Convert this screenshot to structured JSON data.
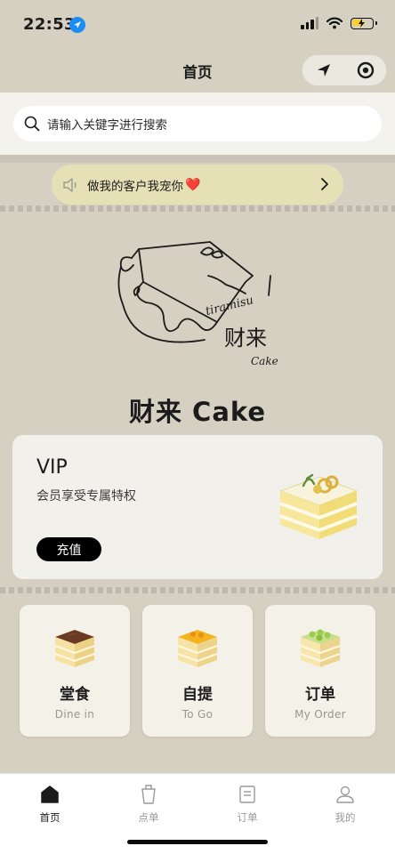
{
  "status_bar": {
    "time": "22:53"
  },
  "nav": {
    "title": "首页"
  },
  "search": {
    "placeholder": "请输入关键字进行搜索"
  },
  "notice": {
    "text": "做我的客户我宠你",
    "emoji": "❤️"
  },
  "brand": {
    "name": "财来 Cake",
    "logo_script": "tiramisu",
    "logo_cn": "财来",
    "logo_en": "Cake"
  },
  "vip": {
    "title": "VIP",
    "subtitle": "会员享受专属特权",
    "button": "充值"
  },
  "actions": [
    {
      "title": "堂食",
      "subtitle": "Dine in",
      "icon": "tiramisu-cake-icon"
    },
    {
      "title": "自提",
      "subtitle": "To Go",
      "icon": "mango-cake-icon"
    },
    {
      "title": "订单",
      "subtitle": "My Order",
      "icon": "grape-cake-icon"
    }
  ],
  "tabbar": [
    {
      "label": "首页",
      "icon": "home-icon",
      "active": true
    },
    {
      "label": "点单",
      "icon": "cup-icon",
      "active": false
    },
    {
      "label": "订单",
      "icon": "receipt-icon",
      "active": false
    },
    {
      "label": "我的",
      "icon": "user-icon",
      "active": false
    }
  ],
  "colors": {
    "background": "#d6d0c2",
    "notice_bg": "#e5e0b5",
    "card_bg": "#f2f0ea",
    "button": "#000000",
    "heart": "#e11d2b"
  }
}
